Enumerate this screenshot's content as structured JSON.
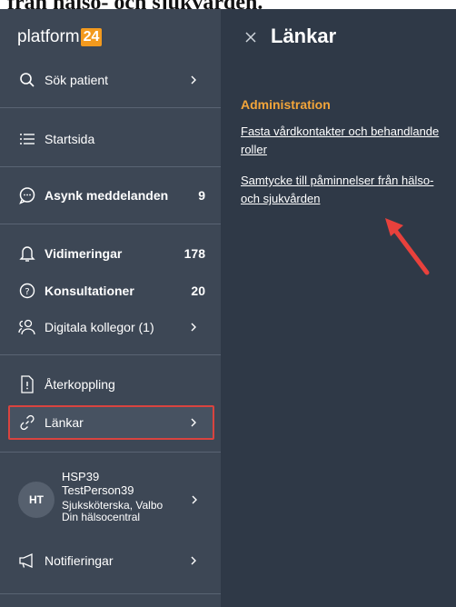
{
  "top_crop_text": "från hälso- och sjukvården.",
  "logo": {
    "text": "platform",
    "badge": "24"
  },
  "sidebar": {
    "search": "Sök patient",
    "start": "Startsida",
    "async": {
      "label": "Asynk meddelanden",
      "count": "9"
    },
    "vidimeringar": {
      "label": "Vidimeringar",
      "count": "178"
    },
    "konsultationer": {
      "label": "Konsultationer",
      "count": "20"
    },
    "digitala": "Digitala kollegor (1)",
    "aterkoppling": "Återkoppling",
    "lankar": "Länkar",
    "user": {
      "initials": "HT",
      "id": "HSP39",
      "name": "TestPerson39",
      "role": "Sjuksköterska, Valbo",
      "unit": "Din hälsocentral"
    },
    "notifieringar": "Notifieringar"
  },
  "panel": {
    "title": "Länkar",
    "section": "Administration",
    "link1": "Fasta vårdkontakter och behandlande roller",
    "link2": "Samtycke till påminnelser från hälso- och sjukvården"
  },
  "colors": {
    "sidebar_bg": "#3d4755",
    "panel_bg": "#2f3947",
    "accent_orange": "#f39a1e",
    "highlight_red": "#d9433f"
  }
}
